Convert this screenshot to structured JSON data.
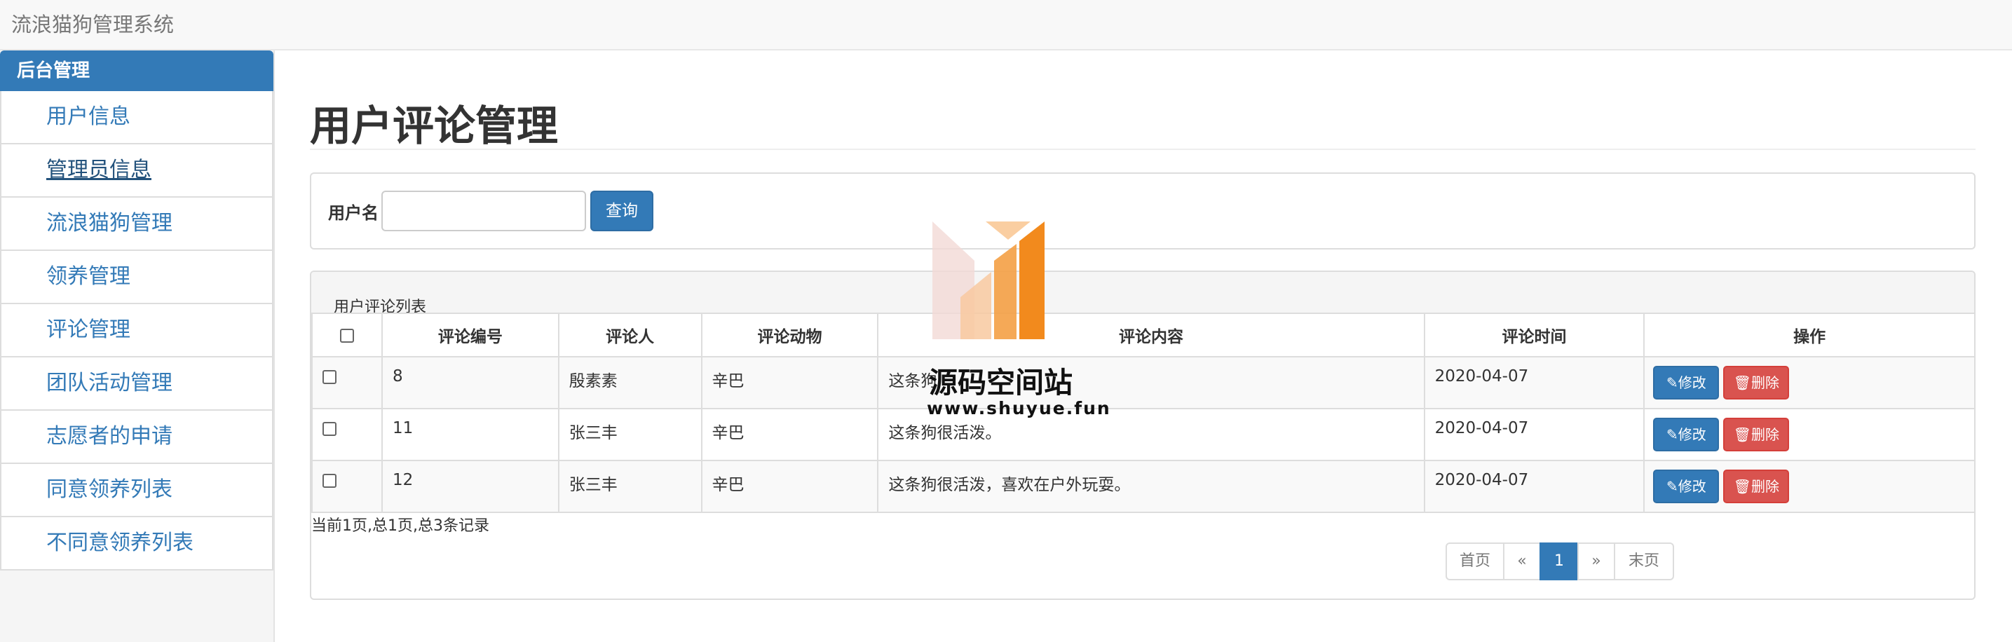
{
  "app": {
    "title": "流浪猫狗管理系统"
  },
  "sidebar": {
    "header": "后台管理",
    "items": [
      {
        "label": "用户信息"
      },
      {
        "label": "管理员信息"
      },
      {
        "label": "流浪猫狗管理"
      },
      {
        "label": "领养管理"
      },
      {
        "label": "评论管理"
      },
      {
        "label": "团队活动管理"
      },
      {
        "label": "志愿者的申请"
      },
      {
        "label": "同意领养列表"
      },
      {
        "label": "不同意领养列表"
      }
    ]
  },
  "main": {
    "title": "用户评论管理",
    "search": {
      "label": "用户名",
      "value": "",
      "button": "查询"
    },
    "list": {
      "caption": "用户评论列表",
      "columns": [
        "评论编号",
        "评论人",
        "评论动物",
        "评论内容",
        "评论时间",
        "操作"
      ],
      "rows": [
        {
          "id": "8",
          "user": "殷素素",
          "animal": "辛巴",
          "content": "这条狗",
          "time": "2020-04-07"
        },
        {
          "id": "11",
          "user": "张三丰",
          "animal": "辛巴",
          "content": "这条狗很活泼。",
          "time": "2020-04-07"
        },
        {
          "id": "12",
          "user": "张三丰",
          "animal": "辛巴",
          "content": "这条狗很活泼，喜欢在户外玩耍。",
          "time": "2020-04-07"
        }
      ],
      "edit_label": "修改",
      "delete_label": "删除"
    },
    "summary": "当前1页,总1页,总3条记录",
    "pager": {
      "first": "首页",
      "prev": "«",
      "current": "1",
      "next": "»",
      "last": "末页"
    }
  },
  "watermark": {
    "name": "源码空间站",
    "url": "www.shuyue.fun"
  },
  "colors": {
    "primary": "#337ab7",
    "danger": "#d9534f",
    "accent": "#f28a1d"
  },
  "icons": {
    "edit": "pencil-icon",
    "delete": "trash-icon"
  }
}
